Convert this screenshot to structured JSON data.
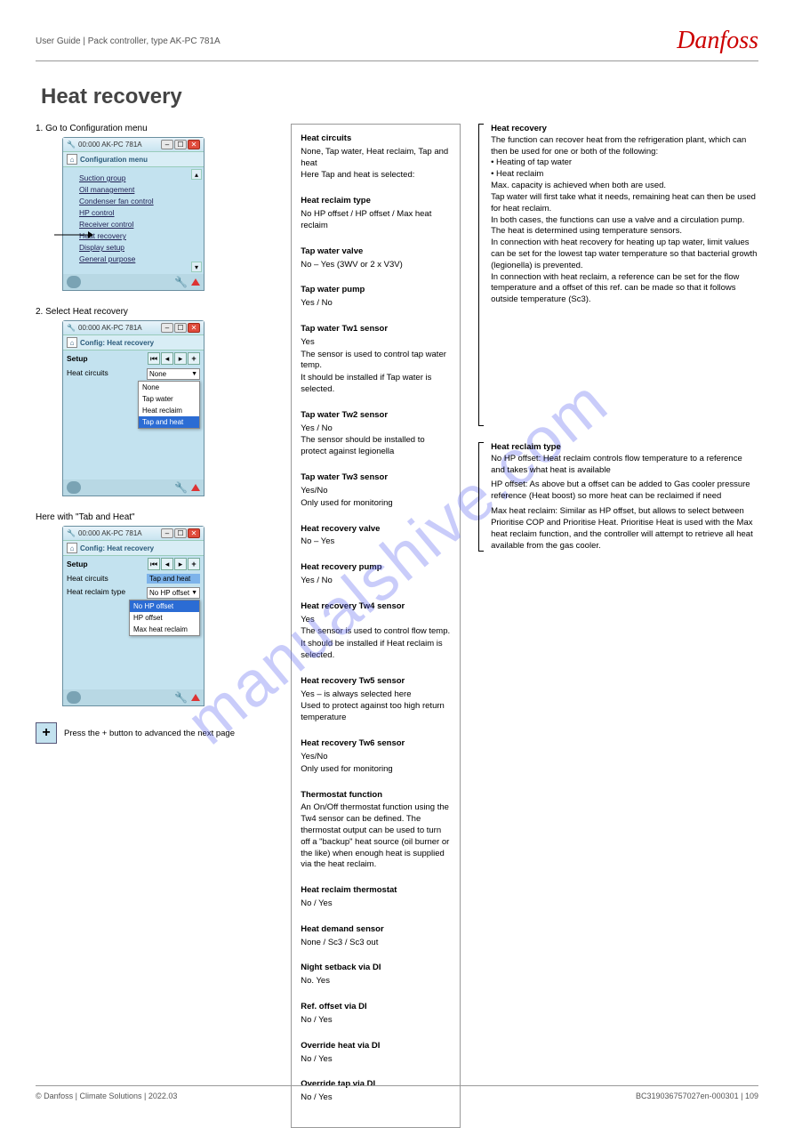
{
  "header": {
    "left": "User Guide | Pack controller, type AK-PC 781A"
  },
  "logo": "Danfoss",
  "title": "Heat recovery",
  "watermark": "manualshive.com",
  "step1": {
    "label": "1. Go to Configuration menu",
    "window_title": "00:000 AK-PC 781A",
    "sub": "Configuration menu",
    "items": [
      "Suction group",
      "Oil management",
      "Condenser fan control",
      "HP control",
      "Receiver control",
      "Heat recovery",
      "Display setup",
      "General purpose"
    ],
    "arrow_target_index": 5
  },
  "step2": {
    "label": "2. Select Heat recovery",
    "window_title": "00:000 AK-PC 781A",
    "sub": "Config: Heat recovery",
    "setup": "Setup",
    "field1": "Heat circuits",
    "sel_value": "None",
    "options": [
      "None",
      "Tap water",
      "Heat reclaim",
      "Tap and heat"
    ],
    "highlight_index": 3
  },
  "step3": {
    "label": "Here with \"Tab and Heat\"",
    "window_title": "00:000 AK-PC 781A",
    "sub": "Config: Heat recovery",
    "setup": "Setup",
    "field1": "Heat circuits",
    "val1": "Tap and heat",
    "field2": "Heat reclaim type",
    "val2": "No HP offset",
    "options": [
      "No HP offset",
      "HP offset",
      "Max heat reclaim"
    ],
    "highlight_index": 0
  },
  "plus_note": "Press the + button to advanced the next page",
  "desc": {
    "b1": {
      "t": "Heat circuits",
      "lines": [
        "None, Tap water, Heat reclaim, Tap and heat",
        "Here Tap and heat is selected:"
      ]
    },
    "b2": {
      "t": "Heat reclaim type",
      "lines": [
        "No HP offset / HP offset / Max heat reclaim"
      ]
    },
    "b3": {
      "t": "Tap water valve",
      "lines": [
        "No – Yes (3WV or 2 x V3V)"
      ]
    },
    "b4": {
      "t": "Tap water pump",
      "lines": [
        "Yes / No"
      ]
    },
    "b5": {
      "t": "Tap water Tw1 sensor",
      "lines": [
        "Yes",
        "The sensor is used to control tap water temp.",
        "It should be installed if Tap water is selected."
      ]
    },
    "b6": {
      "t": "Tap water Tw2 sensor",
      "lines": [
        "Yes / No",
        "The sensor should be installed to protect against legionella"
      ]
    },
    "b7": {
      "t": "Tap water Tw3 sensor",
      "lines": [
        "Yes/No",
        "Only used for monitoring"
      ]
    },
    "b8": {
      "t": "Heat recovery valve",
      "lines": [
        "No – Yes"
      ]
    },
    "b9": {
      "t": "Heat recovery pump",
      "lines": [
        "Yes / No"
      ]
    },
    "b10": {
      "t": "Heat recovery Tw4 sensor",
      "lines": [
        "Yes",
        "The sensor is used to control flow temp.",
        "It should be installed if Heat reclaim is selected."
      ]
    },
    "b11": {
      "t": "Heat recovery Tw5 sensor",
      "lines": [
        "Yes – is always selected here",
        "Used to protect against too high return temperature"
      ]
    },
    "b12": {
      "t": "Heat recovery Tw6 sensor",
      "lines": [
        "Yes/No",
        "Only used for monitoring"
      ]
    },
    "c1": {
      "t": "Thermostat function",
      "lines": [
        "An On/Off thermostat function using the Tw4 sensor can be defined. The thermostat output can be used to turn off a \"backup\" heat source (oil burner or the like) when enough heat is supplied via the heat reclaim."
      ]
    },
    "c2": {
      "t": "Heat reclaim thermostat",
      "lines": [
        "No / Yes"
      ]
    },
    "c3": {
      "t": "Heat demand sensor",
      "lines": [
        "None / Sc3 / Sc3 out"
      ]
    },
    "c4": {
      "t": "Night setback via DI",
      "lines": [
        "No. Yes"
      ]
    },
    "c5": {
      "t": "Ref. offset via DI",
      "lines": [
        "No / Yes"
      ]
    },
    "c6": {
      "t": "Override heat via DI",
      "lines": [
        "No / Yes"
      ]
    },
    "c7": {
      "t": "Override tap via DI",
      "lines": [
        "No / Yes"
      ]
    }
  },
  "right_notes": {
    "n1": {
      "t": "Heat recovery",
      "lines": [
        "The function can recover heat from the refrigeration plant, which can then be used for one or both of the following:",
        "• Heating of tap water",
        "• Heat reclaim",
        "Max. capacity is achieved when both are used.",
        "Tap water will first take what it needs, remaining heat can then be used for heat reclaim.",
        "In both cases, the functions can use a valve and a circulation pump. The heat is determined using temperature sensors.",
        "In connection with heat recovery for heating up tap water, limit values can be set for the lowest tap water temperature so that bacterial growth (legionella) is prevented.",
        "In connection with heat reclaim, a reference can be set for the flow temperature and a offset of this ref. can be made so that it follows outside temperature (Sc3)."
      ]
    },
    "n2": {
      "t": "Heat reclaim type",
      "lines": [
        "No HP offset: Heat reclaim controls flow temperature to a reference and takes what heat is available",
        "HP offset: As above but a offset can be added to Gas cooler pressure reference (Heat boost) so more heat can be reclaimed if need",
        "Max heat reclaim: Similar as HP offset, but allows to select between Prioritise COP and Prioritise Heat. Prioritise Heat is used with the Max heat reclaim function, and the controller will attempt to retrieve all heat available from the gas cooler."
      ]
    }
  },
  "footer": {
    "left": "© Danfoss | Climate Solutions | 2022.03",
    "right": "BC319036757027en-000301 | 109"
  }
}
